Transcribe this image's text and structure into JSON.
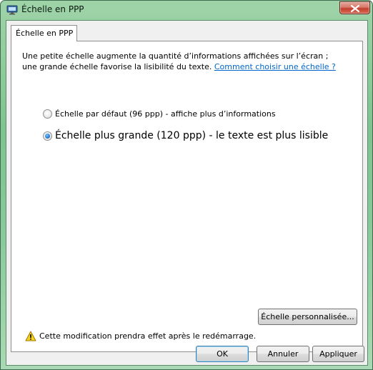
{
  "window": {
    "title": "Échelle en PPP",
    "close_icon": "close-icon"
  },
  "tab": {
    "label": "Échelle en PPP"
  },
  "description": {
    "line1": "Une petite échelle augmente la quantité d’informations affichées sur l’écran ;",
    "line2": "une grande échelle favorise la lisibilité du texte.",
    "link": "Comment choisir une échelle ?"
  },
  "options": [
    {
      "label": "Échelle par défaut (96 ppp) - affiche plus d’informations",
      "selected": false
    },
    {
      "label": "Échelle plus grande (120 ppp) - le texte est plus lisible",
      "selected": true
    }
  ],
  "warning": {
    "icon": "warning-icon",
    "text": "Cette modification prendra effet après le redémarrage."
  },
  "buttons": {
    "custom": "Échelle personnalisée...",
    "ok": "OK",
    "cancel": "Annuler",
    "apply": "Appliquer"
  },
  "colors": {
    "link": "#0066cc",
    "frame": "#87c89a",
    "close": "#c3402f"
  }
}
